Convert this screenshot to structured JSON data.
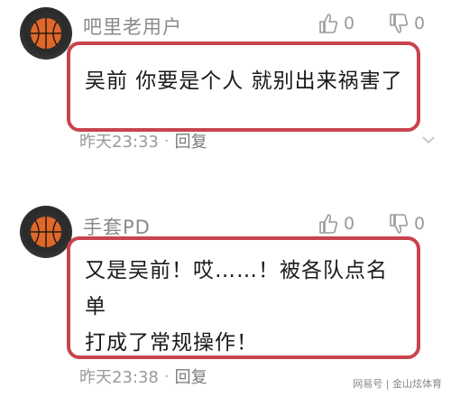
{
  "comments": [
    {
      "username": "吧里老用户",
      "likes": "0",
      "dislikes": "0",
      "text": "吴前 你要是个人 就别出来祸害了",
      "time": "昨天23:33",
      "separator": "·",
      "reply_label": "回复"
    },
    {
      "username": "手套PD",
      "likes": "0",
      "dislikes": "0",
      "text_line1": "又是吴前！哎……！被各队点名单",
      "text_line2": "打成了常规操作！",
      "time": "昨天23:38",
      "separator": "·",
      "reply_label": "回复"
    }
  ],
  "watermark": "网易号 | 金山炫体育",
  "colors": {
    "bubble_border": "#c9434d",
    "meta_text": "#9a9a9a"
  }
}
